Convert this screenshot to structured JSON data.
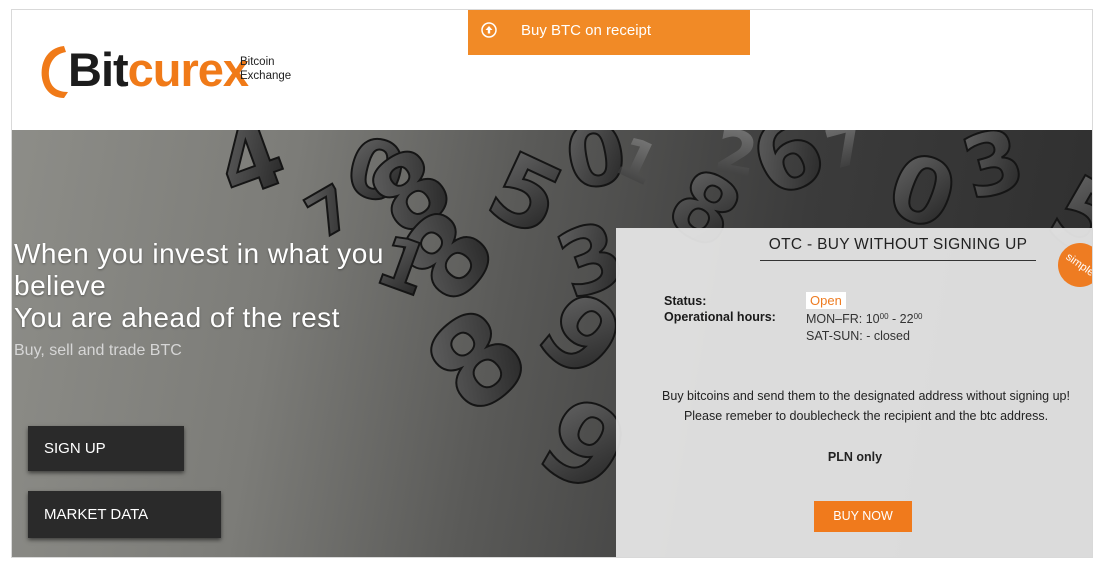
{
  "header": {
    "logo_word_1": "Bit",
    "logo_word_2": "curex",
    "logo_tag_1": "Bitcoin",
    "logo_tag_2": "Exchange",
    "buy_btc_label": "Buy BTC on receipt",
    "buy_btc_icon": "arrow-up-circle-icon"
  },
  "hero": {
    "line1": "When you invest in what you",
    "line2": "believe",
    "line3": "You are ahead of the rest",
    "subtitle": "Buy, sell and trade BTC",
    "signup_label": "SIGN UP",
    "market_label": "MARKET DATA"
  },
  "otc": {
    "title": "OTC - BUY WITHOUT SIGNING UP",
    "badge": "simple",
    "status_label": "Status:",
    "status_value": "Open",
    "hours_label": "Operational hours:",
    "hours_weekday_prefix": "MON–FR: 10",
    "hours_weekday_sup1": "00",
    "hours_weekday_mid": " - 22",
    "hours_weekday_sup2": "00",
    "hours_weekend": "SAT-SUN: - closed",
    "description": "Buy bitcoins and send them to the designated address without signing up! Please remeber to doublecheck the recipient and the btc address.",
    "pln_note": "PLN only",
    "buy_now_label": "BUY NOW"
  },
  "colors": {
    "brand_orange": "#f07a18",
    "button_dark": "#2a2a2a"
  }
}
